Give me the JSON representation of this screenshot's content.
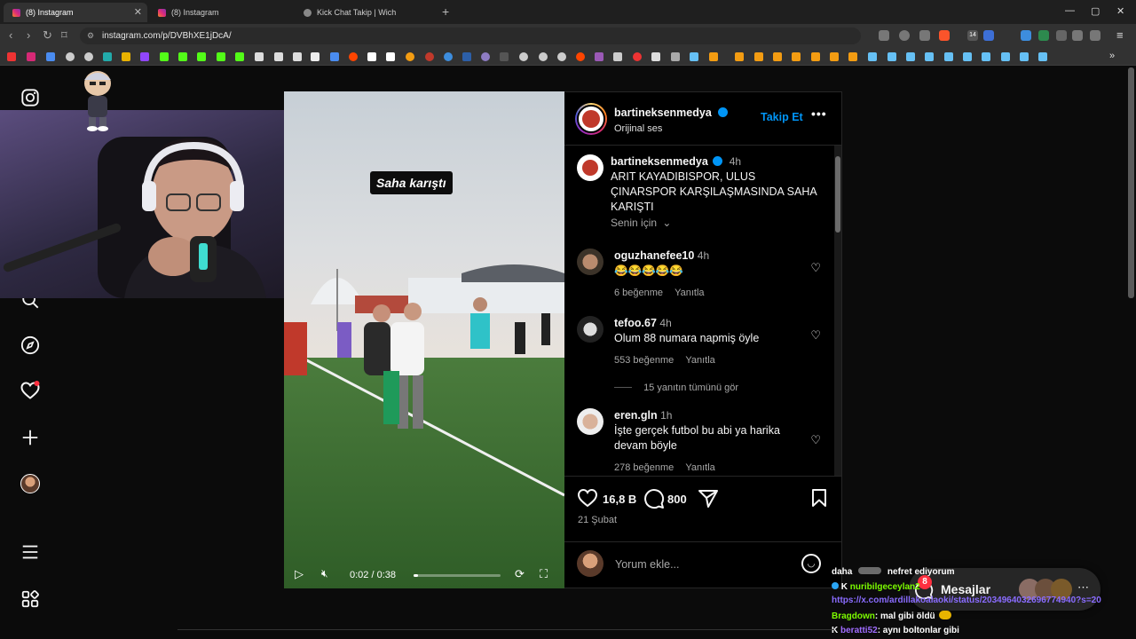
{
  "browser": {
    "tabs": [
      {
        "title": "(8) Instagram",
        "active": true
      },
      {
        "title": "(8) Instagram",
        "active": false
      },
      {
        "title": "Kick Chat Takip | Wich",
        "active": false
      }
    ],
    "url": "instagram.com/p/DVBhXE1jDcA/",
    "ext_badge": "14"
  },
  "post": {
    "author": "bartineksenmedya",
    "audio": "Orijinal ses",
    "follow_label": "Takip Et",
    "caption_time": "4h",
    "caption": "ARIT KAYADIBISPOR, ULUS ÇINARSPOR KARŞILAŞMASINDA SAHA KARIŞTI",
    "for_you": "Senin için",
    "likes": "16,8 B",
    "comments_count": "800",
    "date": "21 Şubat",
    "add_comment_placeholder": "Yorum ekle..."
  },
  "video": {
    "overlay_text": "Saha karıştı",
    "time": "0:02 / 0:38",
    "progress": 0.05
  },
  "comments": [
    {
      "user": "oguzhanefee10",
      "time": "4h",
      "text": "😂😂😂😂😂",
      "likes": "6 beğenme",
      "reply": "Yanıtla"
    },
    {
      "user": "tefoo.67",
      "time": "4h",
      "text": "Olum 88 numara napmiş öyle",
      "likes": "553 beğenme",
      "reply": "Yanıtla"
    },
    {
      "user": "eren.gln",
      "time": "1h",
      "text": "İşte gerçek futbol bu abi ya harika devam böyle",
      "likes": "278 beğenme",
      "reply": "Yanıtla"
    }
  ],
  "view_replies": "15 yanıtın tümünü gör",
  "messages": {
    "label": "Mesajlar",
    "badge": "8"
  },
  "chat": [
    {
      "user": "daha",
      "text": "nefret ediyorum",
      "color": "#ffffff"
    },
    {
      "user": "nuribilgeceylan2",
      "text": "",
      "color": "#7cfc00"
    },
    {
      "user": "",
      "text": "https://x.com/ardillakoalaoki/status/2034964032696774940?s=20",
      "color": "#8a6cff"
    },
    {
      "user": "Bragdown",
      "text": ": mal gibi öldü",
      "color": "#7cfc00"
    },
    {
      "user": "beratti52",
      "text": ": aynı boltonlar gibi",
      "color": "#a06cff"
    }
  ],
  "colors": {
    "accent": "#0095f6",
    "verified": "#0095f6",
    "notif": "#ff3040"
  }
}
